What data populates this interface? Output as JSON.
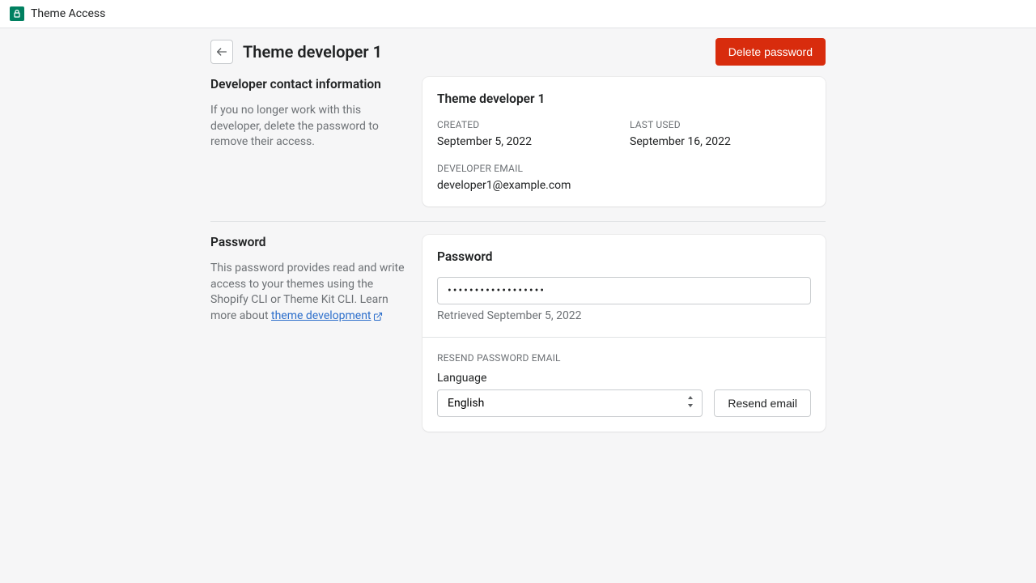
{
  "topbar": {
    "title": "Theme Access"
  },
  "header": {
    "title": "Theme developer 1",
    "delete_label": "Delete password"
  },
  "contact_section": {
    "heading": "Developer contact information",
    "description": "If you no longer work with this developer, delete the password to remove their access.",
    "card": {
      "title": "Theme developer 1",
      "created_label": "CREATED",
      "created_value": "September 5, 2022",
      "last_used_label": "LAST USED",
      "last_used_value": "September 16, 2022",
      "email_label": "DEVELOPER EMAIL",
      "email_value": "developer1@example.com"
    }
  },
  "password_section": {
    "heading": "Password",
    "description": "This password provides read and write access to your themes using the Shopify CLI or Theme Kit CLI. Learn more about ",
    "link_text": "theme development",
    "card": {
      "title": "Password",
      "value": "••••••••••••••••••",
      "retrieved": "Retrieved September 5, 2022",
      "resend_heading": "RESEND PASSWORD EMAIL",
      "language_label": "Language",
      "language_value": "English",
      "resend_button": "Resend email"
    }
  }
}
